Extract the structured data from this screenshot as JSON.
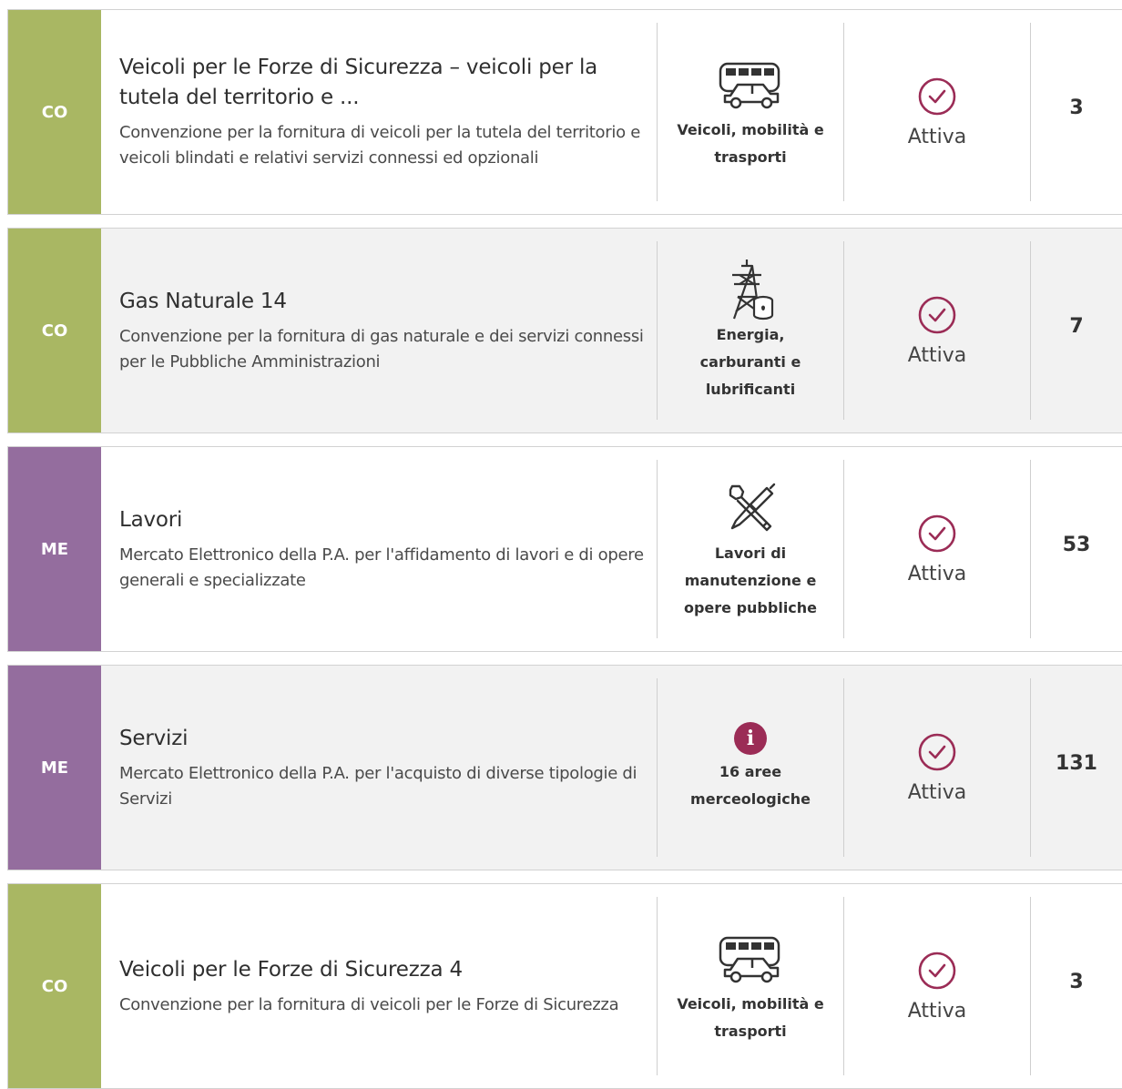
{
  "colors": {
    "co": "#a9b763",
    "me": "#946d9e",
    "accent": "#9b2c56"
  },
  "rows": [
    {
      "type": "CO",
      "title": "Veicoli per le Forze di Sicurezza – veicoli per la tutela del territorio e ...",
      "subtitle": "Convenzione per la fornitura di veicoli per la tutela del territorio e veicoli blindati e relativi servizi connessi ed opzionali",
      "category": "Veicoli, mobilità e trasporti",
      "category_icon": "bus-car-icon",
      "status": "Attiva",
      "count": "3"
    },
    {
      "type": "CO",
      "title": "Gas Naturale 14",
      "subtitle": "Convenzione per la fornitura di gas naturale e dei servizi connessi per le Pubbliche Amministrazioni",
      "category": "Energia, carburanti e lubrificanti",
      "category_icon": "power-pylon-barrel-icon",
      "status": "Attiva",
      "count": "7"
    },
    {
      "type": "ME",
      "title": "Lavori",
      "subtitle": "Mercato Elettronico della P.A. per l'affidamento di lavori e di opere generali e specializzate",
      "category": "Lavori di manutenzione e opere pubbliche",
      "category_icon": "wrench-screwdriver-icon",
      "status": "Attiva",
      "count": "53"
    },
    {
      "type": "ME",
      "title": "Servizi",
      "subtitle": "Mercato Elettronico della P.A. per l'acquisto di diverse tipologie di Servizi",
      "category": "16 aree merceologiche",
      "category_icon": "info-icon",
      "status": "Attiva",
      "count": "131"
    },
    {
      "type": "CO",
      "title": "Veicoli per le Forze di Sicurezza 4",
      "subtitle": "Convenzione per la fornitura di veicoli per le Forze di Sicurezza",
      "category": "Veicoli, mobilità e trasporti",
      "category_icon": "bus-car-icon",
      "status": "Attiva",
      "count": "3"
    }
  ]
}
